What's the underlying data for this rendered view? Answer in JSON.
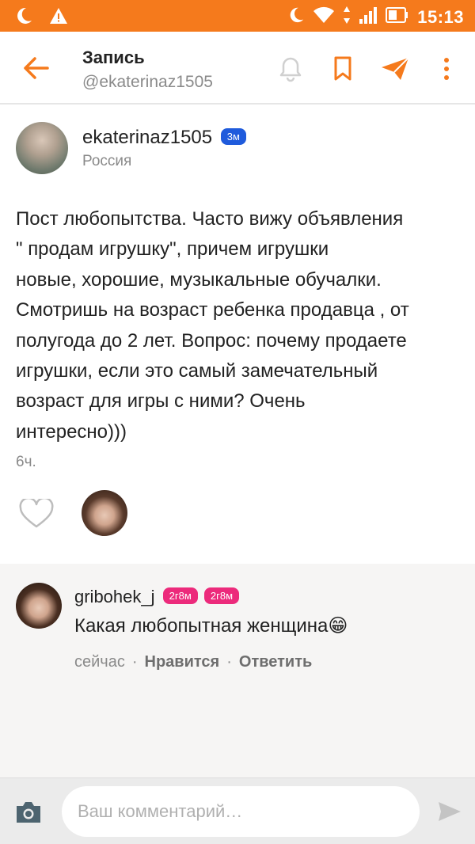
{
  "status_bar": {
    "time": "15:13"
  },
  "header": {
    "title": "Запись",
    "subtitle": "@ekaterinaz1505"
  },
  "post": {
    "author": "ekaterinaz1505",
    "badge": "3м",
    "location": "Россия",
    "text_lines": [
      "Пост любопытства. Часто вижу объявления",
      "\" продам игрушку\", причем игрушки",
      "новые, хорошие, музыкальные обучалки.",
      "Смотришь на возраст ребенка продавца , от",
      "полугода до 2 лет. Вопрос: почему продаете",
      "игрушки, если это самый замечательный",
      "возраст для игры с ними? Очень",
      "интересно)))"
    ],
    "time": "6ч."
  },
  "comments": [
    {
      "author": "gribohek_j",
      "badges": [
        "2г8м",
        "2г8м"
      ],
      "text": "Какая любопытная женщина😁",
      "time": "сейчас",
      "like_label": "Нравится",
      "reply_label": "Ответить"
    }
  ],
  "input": {
    "placeholder": "Ваш комментарий…"
  },
  "colors": {
    "accent": "#f57a1c",
    "badge_blue": "#1f5bdc",
    "badge_pink": "#ec2a7b"
  }
}
